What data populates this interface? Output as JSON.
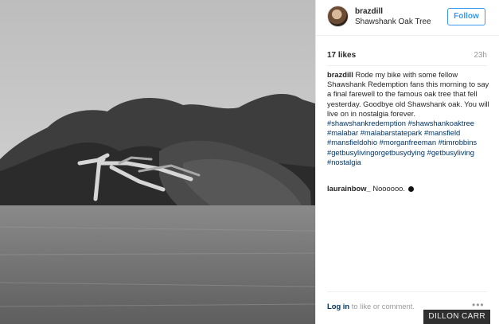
{
  "post": {
    "username": "brazdill",
    "location": "Shawshank Oak Tree",
    "follow_label": "Follow",
    "likes": "17 likes",
    "time_ago": "23h",
    "caption_user": "brazdill",
    "caption_text": "Rode my bike with some fellow Shawshank Redemption fans this morning to say a final farewell to the famous oak tree that fell yesterday. Goodbye old Shawshank oak. You will live on in nostalgia forever.",
    "hashtags": "#shawshankredemption #shawshankoaktree #malabar #malabarstatepark #mansfield #mansfieldohio #morganfreeman #timrobbins #getbusylivingorgetbusydying #getbusyliving #nostalgia",
    "comment_user": "laurainbow_",
    "comment_text": "Noooooo.",
    "login_link": "Log in",
    "login_rest": "to like or comment.",
    "more_icon": "•••"
  },
  "photo": {
    "description_icon": "fallen-oak-photo"
  },
  "credit": "DILLON CARR"
}
